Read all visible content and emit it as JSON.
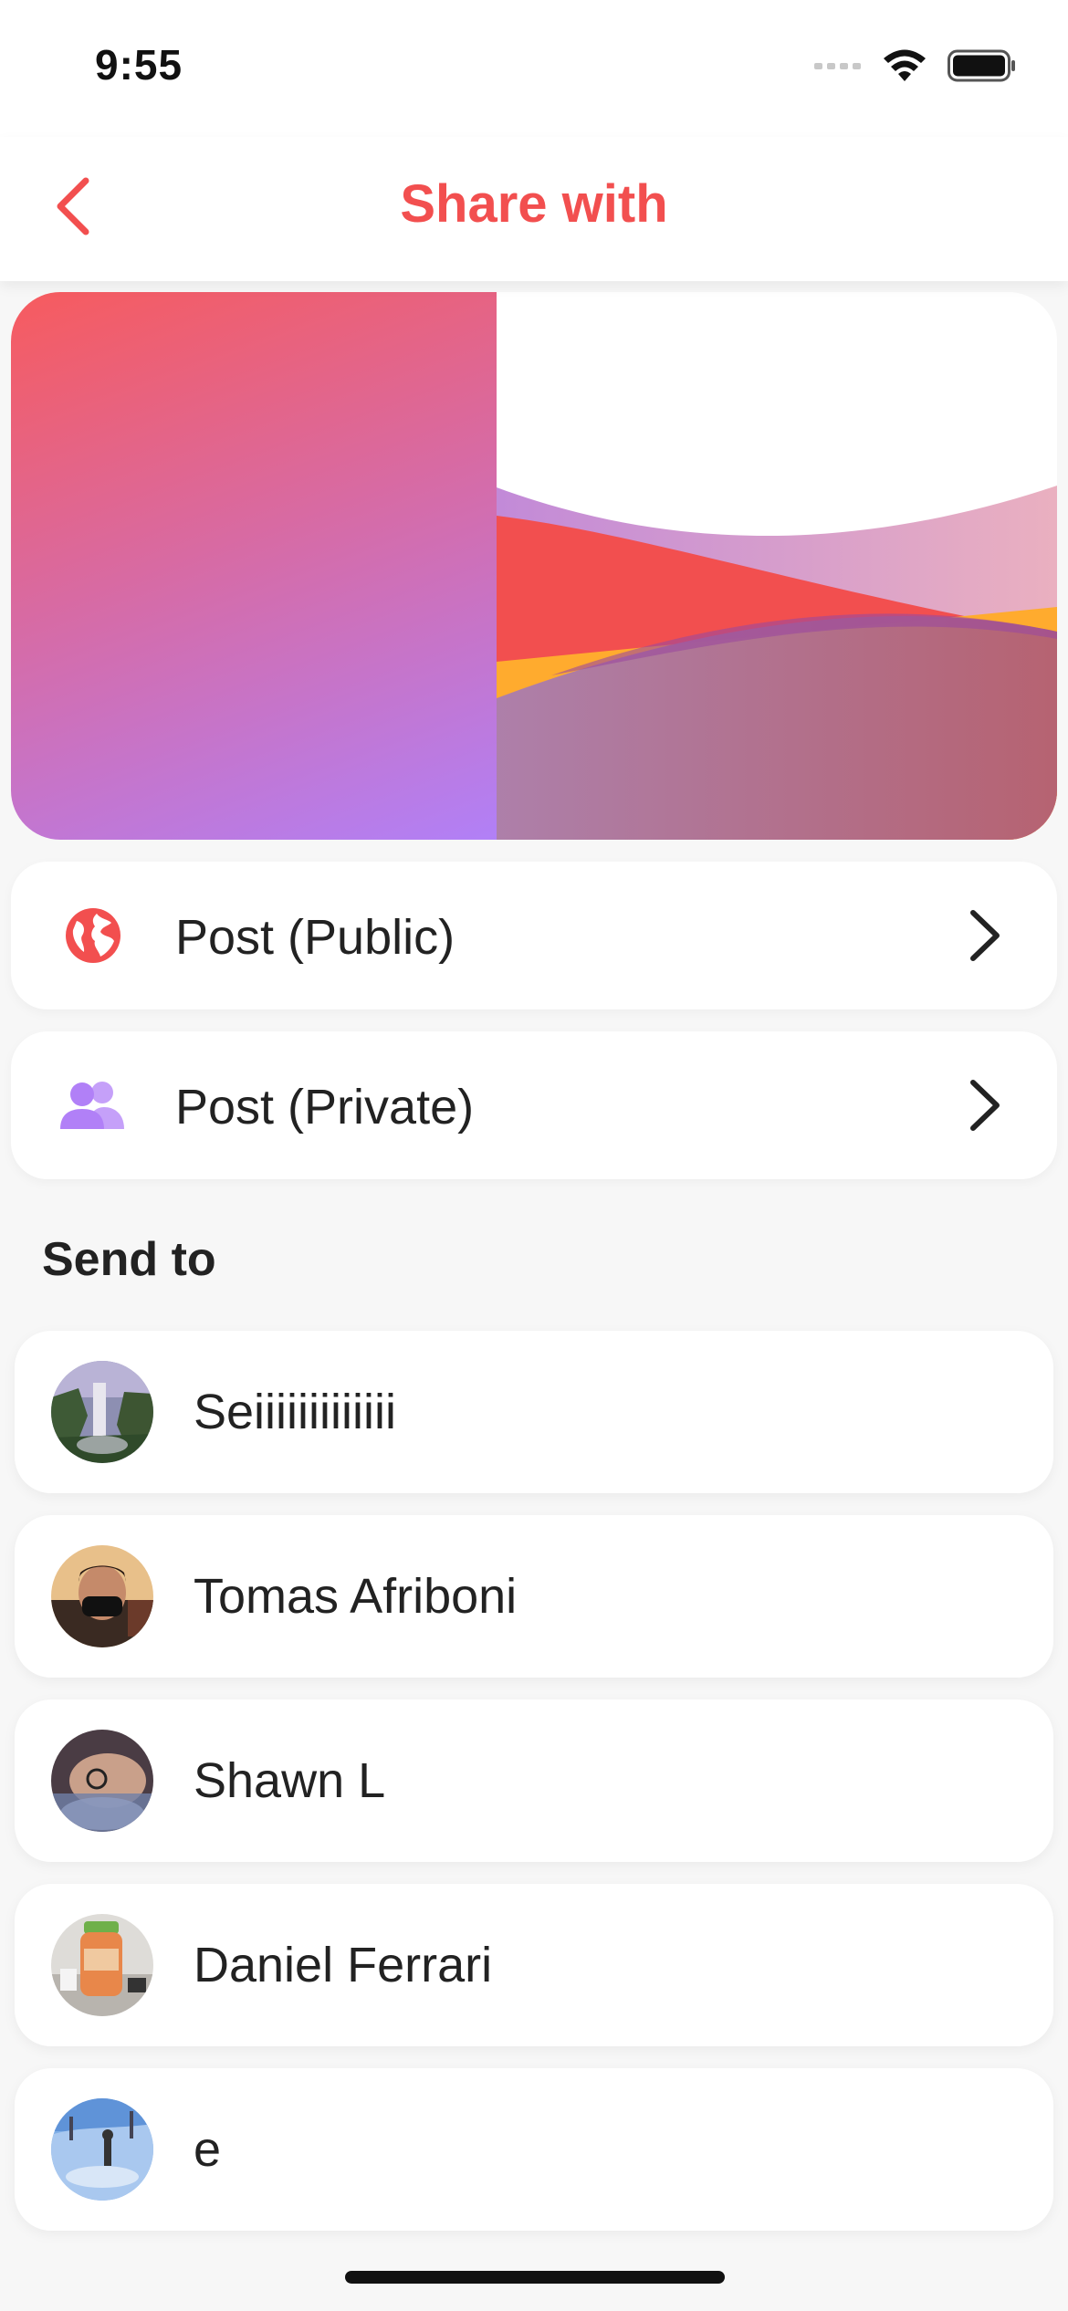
{
  "status_bar": {
    "time": "9:55"
  },
  "header": {
    "title": "Share with",
    "accent_color": "#f24f4f"
  },
  "post_options": [
    {
      "label": "Post (Public)",
      "icon": "globe-icon",
      "icon_color": "#f24f4f"
    },
    {
      "label": "Post (Private)",
      "icon": "people-icon",
      "icon_color": "#b180f7"
    }
  ],
  "send_to": {
    "title": "Send to",
    "contacts": [
      {
        "name": "Seiiiiiiiiiiiii",
        "avatar": "waterfall-avatar"
      },
      {
        "name": "Tomas Afriboni",
        "avatar": "person-mask-avatar"
      },
      {
        "name": "Shawn L",
        "avatar": "person-avatar"
      },
      {
        "name": "Daniel Ferrari",
        "avatar": "bottle-avatar"
      },
      {
        "name": "e",
        "avatar": "snow-avatar"
      }
    ]
  }
}
